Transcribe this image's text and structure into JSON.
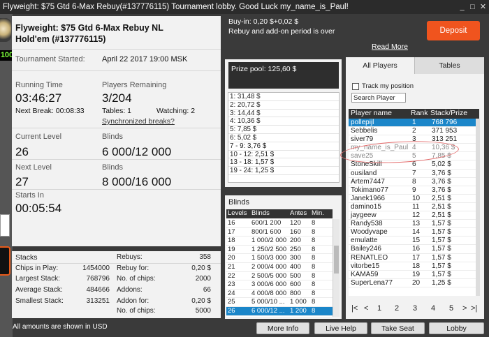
{
  "window": {
    "title": "Flyweight: $75 Gtd 6-Max Rebuy(#137776115) Tournament lobby. Good Luck my_name_is_Paul!",
    "min_label": "_",
    "max_label": "□",
    "close_label": "✕"
  },
  "left_strip": {
    "badge": "100"
  },
  "header": {
    "buyin": "Buy-in: 0,20 $+0,02 $",
    "rebuy_status": "Rebuy and add-on period is over",
    "read_more": "Read More",
    "deposit_label": "Deposit"
  },
  "tournament": {
    "title": "Flyweight: $75 Gtd 6-Max Rebuy NL Hold'em (#137776115)",
    "started_label": "Tournament Started:",
    "started_value": "April 22 2017   19:00 MSK",
    "running_time_label": "Running Time",
    "running_time_value": "03:46:27",
    "next_break_label": "Next Break: 00:08:33",
    "players_remaining_label": "Players Remaining",
    "players_remaining_value": "3/204",
    "tables_label": "Tables: 1",
    "watching_label": "Watching: 2",
    "sync_breaks": "Synchronized breaks?",
    "current_level_label": "Current Level",
    "current_level_value": "26",
    "blinds_label": "Blinds",
    "current_blinds": "6 000/12 000",
    "next_level_label": "Next Level",
    "next_level_value": "27",
    "next_blinds_label": "Blinds",
    "next_blinds": "8 000/16 000",
    "starts_in_label": "Starts In",
    "starts_in_value": "00:05:54"
  },
  "stats": {
    "stacks_label": "Stacks",
    "chips_in_play_label": "Chips in Play:",
    "chips_in_play": "1454000",
    "largest_label": "Largest Stack:",
    "largest": "768796",
    "average_label": "Average Stack:",
    "average": "484666",
    "smallest_label": "Smallest Stack:",
    "smallest": "313251",
    "rebuys_label": "Rebuys:",
    "rebuys": "358",
    "rebuy_for_label": "Rebuy for:",
    "rebuy_for": "0,20 $",
    "no_chips_label": "No. of chips:",
    "rebuy_chips": "2000",
    "addons_label": "Addons:",
    "addons": "66",
    "addon_for_label": "Addon for:",
    "addon_for": "0,20 $",
    "no_chips_label2": "No. of chips:",
    "addon_chips": "5000"
  },
  "prize_pool": {
    "title": "Prize pool: 125,60 $",
    "rows": [
      "1: 31,48 $",
      "2: 20,72 $",
      "3: 14,44 $",
      "4: 10,36 $",
      "5: 7,85 $",
      "6: 5,02 $",
      "7 - 9: 3,76 $",
      "10 - 12: 2,51 $",
      "13 - 18: 1,57 $",
      "19 - 24: 1,25 $"
    ]
  },
  "blinds": {
    "title": "Blinds",
    "headers": [
      "Levels",
      "Blinds",
      "Antes",
      "Min."
    ],
    "rows": [
      [
        "16",
        "600/1 200",
        "120",
        "8"
      ],
      [
        "17",
        "800/1 600",
        "160",
        "8"
      ],
      [
        "18",
        "1 000/2 000",
        "200",
        "8"
      ],
      [
        "19",
        "1 250/2 500",
        "250",
        "8"
      ],
      [
        "20",
        "1 500/3 000",
        "300",
        "8"
      ],
      [
        "21",
        "2 000/4 000",
        "400",
        "8"
      ],
      [
        "22",
        "2 500/5 000",
        "500",
        "8"
      ],
      [
        "23",
        "3 000/6 000",
        "600",
        "8"
      ],
      [
        "24",
        "4 000/8 000",
        "800",
        "8"
      ],
      [
        "25",
        "5 000/10 ...",
        "1 000",
        "8"
      ],
      [
        "26",
        "6 000/12 ...",
        "1 200",
        "8"
      ]
    ]
  },
  "players": {
    "tab_all": "All Players",
    "tab_tables": "Tables",
    "track_label": "Track my position",
    "search_value": "Search Player",
    "headers": [
      "Player name",
      "Rank",
      "Stack/Prize"
    ],
    "rows": [
      [
        "pollepijl",
        "1",
        "768 796"
      ],
      [
        "Sebbelis",
        "2",
        "371 953"
      ],
      [
        "siver79",
        "3",
        "313 251"
      ],
      [
        "my_name_is_Paul",
        "4",
        "10,36 $"
      ],
      [
        "save25",
        "5",
        "7,85 $"
      ],
      [
        "StoneSkill",
        "6",
        "5,02 $"
      ],
      [
        "ousiland",
        "7",
        "3,76 $"
      ],
      [
        "Artem7447",
        "8",
        "3,76 $"
      ],
      [
        "Tokimano77",
        "9",
        "3,76 $"
      ],
      [
        "Janek1966",
        "10",
        "2,51 $"
      ],
      [
        "damino15",
        "11",
        "2,51 $"
      ],
      [
        "jaygeew",
        "12",
        "2,51 $"
      ],
      [
        "Randy538",
        "13",
        "1,57 $"
      ],
      [
        "Woodyvape",
        "14",
        "1,57 $"
      ],
      [
        "emulatte",
        "15",
        "1,57 $"
      ],
      [
        "Bailey246",
        "16",
        "1,57 $"
      ],
      [
        "RENATLEO",
        "17",
        "1,57 $"
      ],
      [
        "vitorbe15",
        "18",
        "1,57 $"
      ],
      [
        "KAMA59",
        "19",
        "1,57 $"
      ],
      [
        "SuperLena77",
        "20",
        "1,25 $"
      ]
    ],
    "pager": [
      "|<",
      "<",
      "1",
      "2",
      "3",
      "4",
      "5",
      ">",
      ">|"
    ]
  },
  "footer": {
    "note": "All amounts are shown in USD",
    "more_info": "More Info",
    "live_help": "Live Help",
    "take_seat": "Take Seat",
    "lobby": "Lobby"
  }
}
